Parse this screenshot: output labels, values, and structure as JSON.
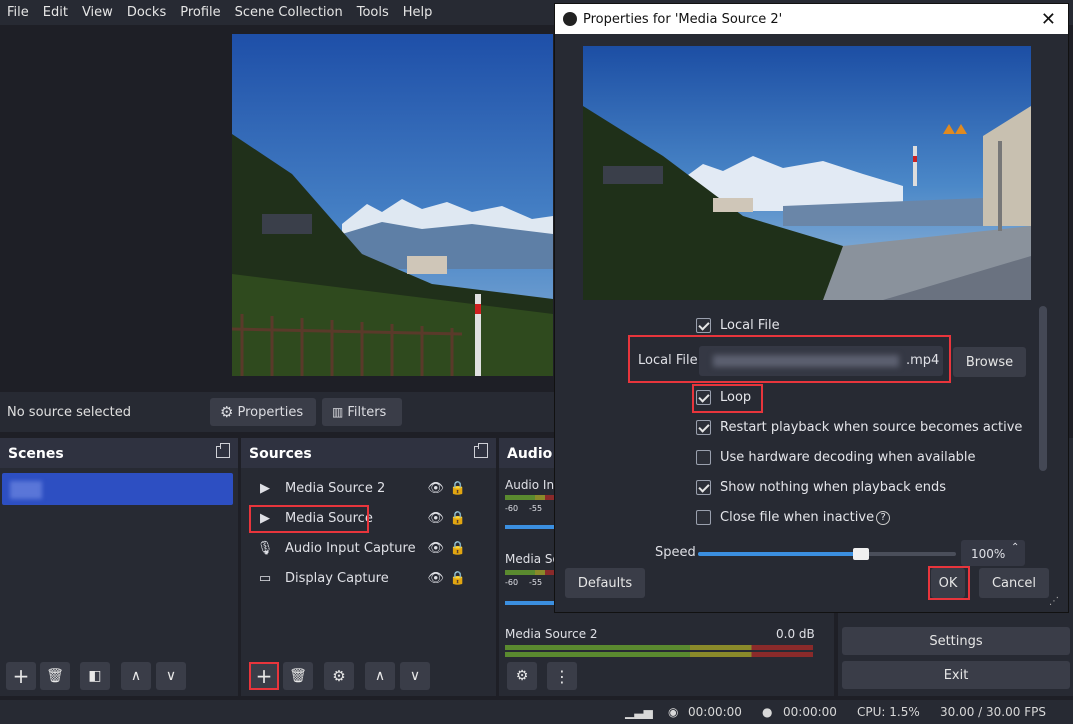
{
  "menu": [
    "File",
    "Edit",
    "View",
    "Docks",
    "Profile",
    "Scene Collection",
    "Tools",
    "Help"
  ],
  "context_bar": {
    "status": "No source selected",
    "properties_label": "Properties",
    "filters_label": "Filters"
  },
  "scenes": {
    "title": "Scenes"
  },
  "sources": {
    "title": "Sources",
    "items": [
      {
        "label": "Media Source 2",
        "icon": "play-icon"
      },
      {
        "label": "Media Source",
        "icon": "play-icon"
      },
      {
        "label": "Audio Input Capture",
        "icon": "microphone-icon"
      },
      {
        "label": "Display Capture",
        "icon": "monitor-icon"
      }
    ]
  },
  "audio": {
    "title": "Audio",
    "channels": [
      {
        "name": "Audio In",
        "ticks": [
          "-60",
          "-55"
        ]
      },
      {
        "name": "Media So",
        "ticks": [
          "-60",
          "-55"
        ]
      },
      {
        "name": "Media Source 2",
        "level": "0.0 dB"
      }
    ]
  },
  "controls": {
    "settings": "Settings",
    "exit": "Exit"
  },
  "status": {
    "time1": "00:00:00",
    "time2": "00:00:00",
    "cpu": "CPU: 1.5%",
    "fps": "30.00 / 30.00 FPS"
  },
  "dialog": {
    "title": "Properties for 'Media Source 2'",
    "local_file_checkbox": "Local File",
    "local_file_label": "Local File",
    "local_file_value": ".mp4",
    "browse": "Browse",
    "options": [
      {
        "label": "Loop",
        "checked": true
      },
      {
        "label": "Restart playback when source becomes active",
        "checked": true
      },
      {
        "label": "Use hardware decoding when available",
        "checked": false
      },
      {
        "label": "Show nothing when playback ends",
        "checked": true
      },
      {
        "label": "Close file when inactive",
        "checked": false
      }
    ],
    "speed_label": "Speed",
    "speed_value": "100%",
    "speed_fraction": 0.63,
    "defaults": "Defaults",
    "ok": "OK",
    "cancel": "Cancel"
  },
  "colors": {
    "highlight": "#e8353c",
    "accent": "#2d4fc2",
    "slider": "#3b8fe0"
  }
}
